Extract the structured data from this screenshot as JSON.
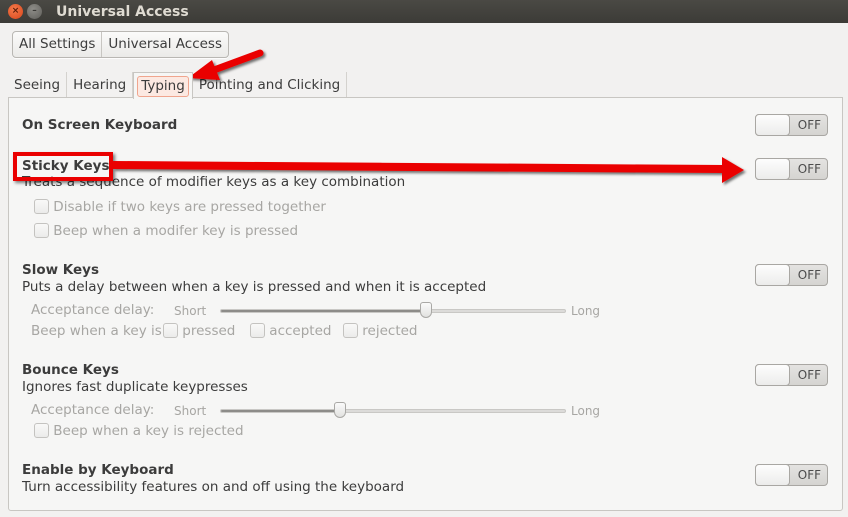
{
  "window": {
    "title": "Universal Access",
    "close_icon": "close-icon",
    "minimize_icon": "minimize-icon"
  },
  "breadcrumb": [
    "All Settings",
    "Universal Access"
  ],
  "tabs": [
    {
      "label": "Seeing",
      "active": false
    },
    {
      "label": "Hearing",
      "active": false
    },
    {
      "label": "Typing",
      "active": true
    },
    {
      "label": "Pointing and Clicking",
      "active": false
    }
  ],
  "sections": {
    "on_screen_keyboard": {
      "title": "On Screen Keyboard",
      "toggle": "OFF"
    },
    "sticky_keys": {
      "title": "Sticky Keys",
      "description": "Treats a sequence of modifier keys as a key combination",
      "toggle": "OFF",
      "options": [
        {
          "label": "Disable if two keys are pressed together",
          "checked": false
        },
        {
          "label": "Beep when a modifer key is pressed",
          "checked": false
        }
      ]
    },
    "slow_keys": {
      "title": "Slow Keys",
      "description": "Puts a delay between when a key is pressed and when it is accepted",
      "toggle": "OFF",
      "delay_label": "Acceptance delay:",
      "short_label": "Short",
      "long_label": "Long",
      "delay_value": 0.6,
      "beep_label": "Beep when a key is",
      "beep_options": [
        {
          "label": "pressed",
          "checked": false
        },
        {
          "label": "accepted",
          "checked": false
        },
        {
          "label": "rejected",
          "checked": false
        }
      ]
    },
    "bounce_keys": {
      "title": "Bounce Keys",
      "description": "Ignores fast duplicate keypresses",
      "toggle": "OFF",
      "delay_label": "Acceptance delay:",
      "short_label": "Short",
      "long_label": "Long",
      "delay_value": 0.34,
      "beep_option": {
        "label": "Beep when a key is rejected",
        "checked": false
      }
    },
    "enable_by_keyboard": {
      "title": "Enable by Keyboard",
      "description": "Turn accessibility features on and off using the keyboard",
      "toggle": "OFF"
    }
  },
  "annotations": {
    "color": "#ea0000",
    "items": [
      "arrow-to-typing-tab",
      "box-around-sticky-keys",
      "arrow-to-sticky-keys-toggle"
    ]
  }
}
